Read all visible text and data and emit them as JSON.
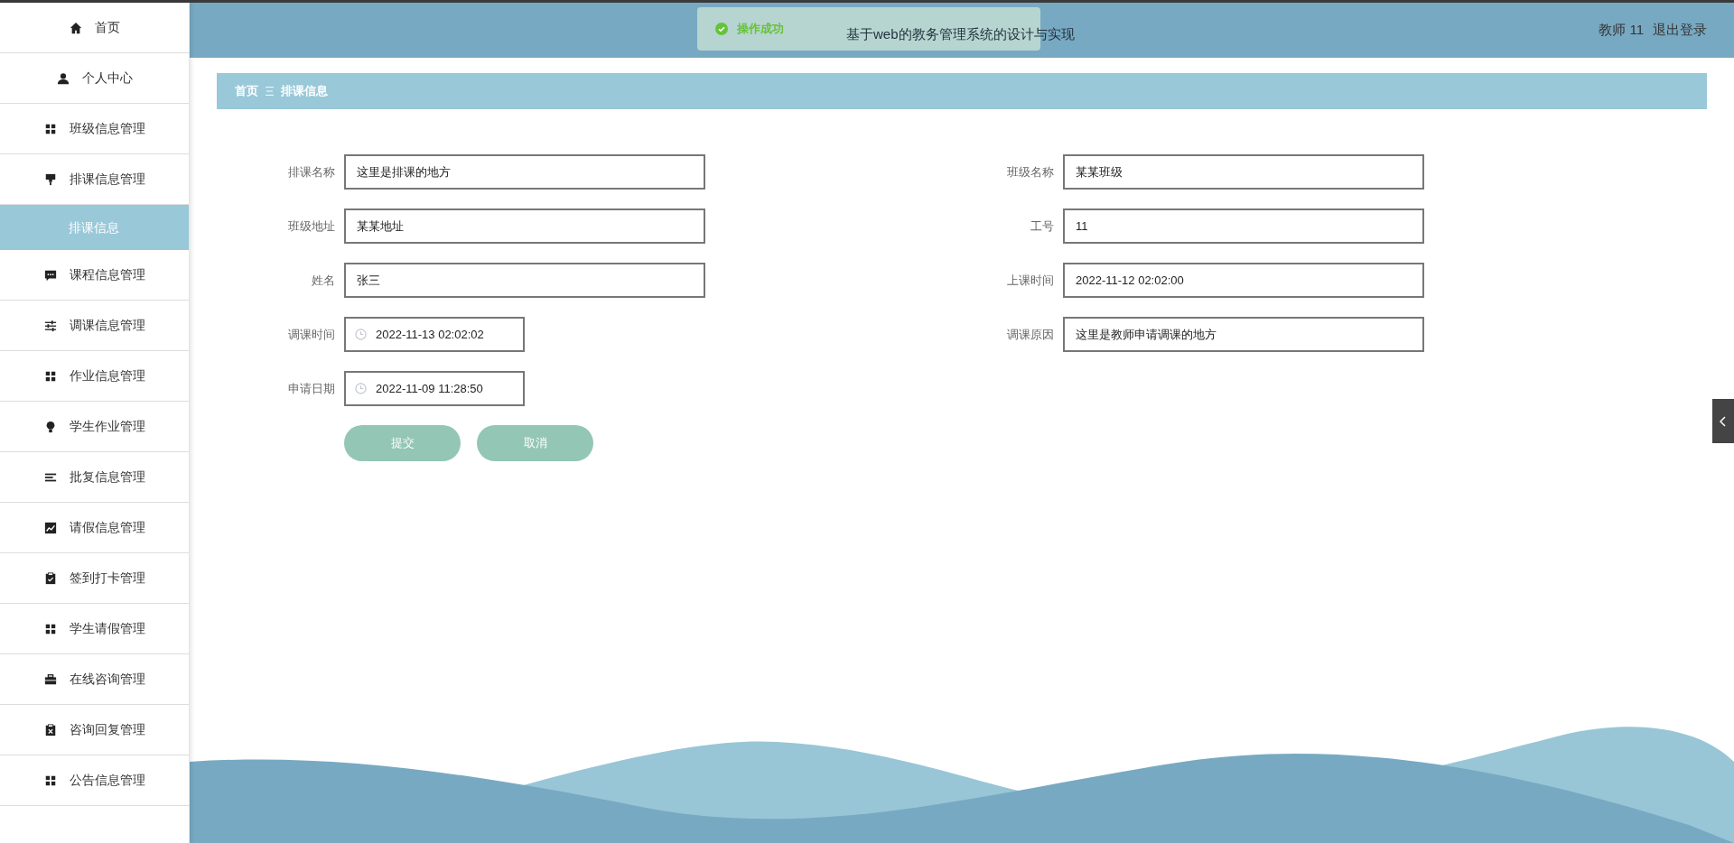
{
  "sidebar": {
    "items": [
      {
        "label": "首页",
        "selected": false
      },
      {
        "label": "个人中心",
        "selected": false
      },
      {
        "label": "班级信息管理",
        "selected": false
      },
      {
        "label": "排课信息管理",
        "selected": false,
        "expanded": true,
        "children": [
          {
            "label": "排课信息",
            "selected": true
          }
        ]
      },
      {
        "label": "课程信息管理",
        "selected": false
      },
      {
        "label": "调课信息管理",
        "selected": false
      },
      {
        "label": "作业信息管理",
        "selected": false
      },
      {
        "label": "学生作业管理",
        "selected": false
      },
      {
        "label": "批复信息管理",
        "selected": false
      },
      {
        "label": "请假信息管理",
        "selected": false
      },
      {
        "label": "签到打卡管理",
        "selected": false
      },
      {
        "label": "学生请假管理",
        "selected": false
      },
      {
        "label": "在线咨询管理",
        "selected": false
      },
      {
        "label": "咨询回复管理",
        "selected": false
      },
      {
        "label": "公告信息管理",
        "selected": false
      }
    ]
  },
  "header": {
    "title": "基于web的教务管理系统的设计与实现",
    "user": "教师 11",
    "logout": "退出登录"
  },
  "toast": {
    "text": "操作成功"
  },
  "breadcrumb": [
    "首页",
    "排课信息"
  ],
  "form": {
    "left": [
      {
        "label": "排课名称",
        "value": "这里是排课的地方",
        "kind": "text"
      },
      {
        "label": "班级地址",
        "value": "某某地址",
        "kind": "text"
      },
      {
        "label": "姓名",
        "value": "张三",
        "kind": "text"
      },
      {
        "label": "调课时间",
        "value": "2022-11-13 02:02:02",
        "kind": "datetime"
      },
      {
        "label": "申请日期",
        "value": "2022-11-09 11:28:50",
        "kind": "datetime"
      }
    ],
    "right": [
      {
        "label": "班级名称",
        "value": "某某班级",
        "kind": "text"
      },
      {
        "label": "工号",
        "value": "11",
        "kind": "text"
      },
      {
        "label": "上课时间",
        "value": "2022-11-12 02:02:00",
        "kind": "text"
      },
      {
        "label": "调课原因",
        "value": "这里是教师申请调课的地方",
        "kind": "text"
      }
    ],
    "buttons": [
      "提交",
      "取消"
    ]
  }
}
